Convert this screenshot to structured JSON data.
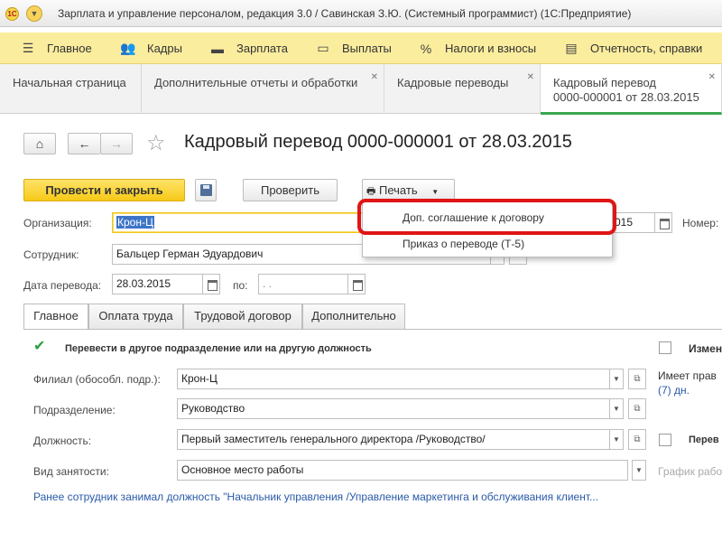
{
  "titlebar": {
    "logo": "1С",
    "title": "Зарплата и управление персоналом, редакция 3.0 / Савинская З.Ю. (Системный программист)  (1С:Предприятие)"
  },
  "sections": [
    {
      "label": "Главное",
      "icon": "menu-icon"
    },
    {
      "label": "Кадры",
      "icon": "people-icon"
    },
    {
      "label": "Зарплата",
      "icon": "money-icon"
    },
    {
      "label": "Выплаты",
      "icon": "payments-icon"
    },
    {
      "label": "Налоги и взносы",
      "icon": "percent-icon"
    },
    {
      "label": "Отчетность, справки",
      "icon": "reports-icon"
    }
  ],
  "window_tabs": [
    {
      "label": "Начальная страница"
    },
    {
      "label": "Дополнительные отчеты и обработки"
    },
    {
      "label": "Кадровые переводы"
    },
    {
      "label_line1": "Кадровый перевод",
      "label_line2": "0000-000001 от 28.03.2015"
    }
  ],
  "form": {
    "title": "Кадровый перевод 0000-000001 от 28.03.2015",
    "buttons": {
      "post_close": "Провести и закрыть",
      "check": "Проверить",
      "print": "Печать"
    },
    "print_menu": [
      "Доп. соглашение к договору",
      "Приказ о переводе (Т-5)"
    ],
    "organization_label": "Организация:",
    "organization_value": "Крон-Ц",
    "date_partial": "015",
    "number_label": "Номер:",
    "employee_label": "Сотрудник:",
    "employee_value": "Бальцер Герман Эдуардович",
    "transfer_date_label": "Дата перевода:",
    "transfer_date_value": "28.03.2015",
    "to_label": "по:",
    "to_value": "  .  .",
    "tabs": [
      "Главное",
      "Оплата труда",
      "Трудовой договор",
      "Дополнительно"
    ],
    "main_tab": {
      "transfer_checkbox_label": "Перевести в другое подразделение или на другую должность",
      "change_label": "Измен",
      "branch_label": "Филиал (обособл. подр.):",
      "branch_value": "Крон-Ц",
      "right_text1": "Имеет прав",
      "right_text2": "(7) дн.",
      "department_label": "Подразделение:",
      "department_value": "Руководство",
      "position_label": "Должность:",
      "position_value": "Первый заместитель генерального директора /Руководство/",
      "right_check_label": "Перев",
      "employment_label": "Вид занятости:",
      "employment_value": "Основное место работы",
      "schedule_label": "График рабо",
      "previous_position_link": "Ранее сотрудник занимал должность \"Начальник управления /Управление маркетинга и обслуживания клиент..."
    }
  }
}
